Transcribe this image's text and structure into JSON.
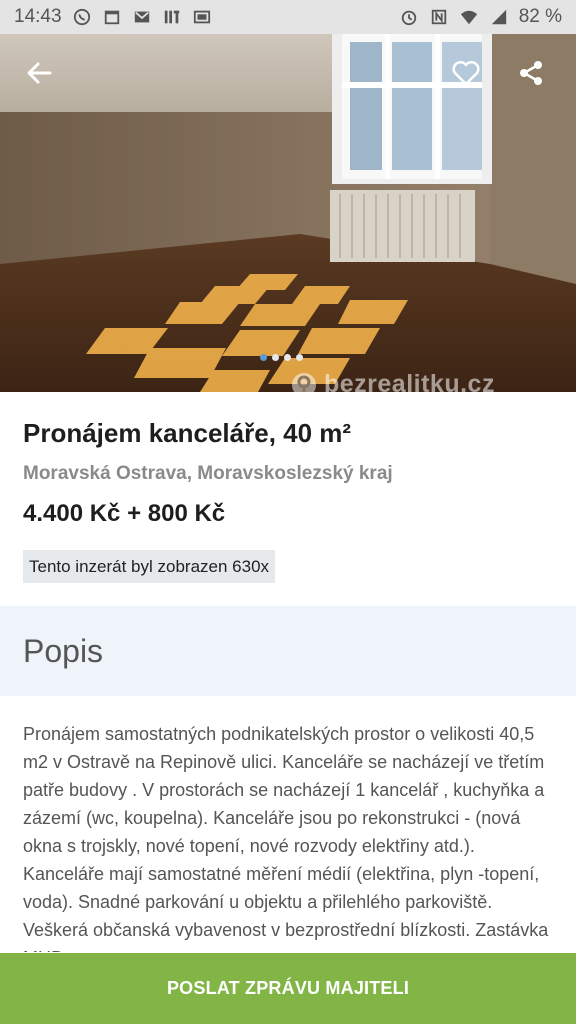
{
  "status_bar": {
    "time": "14:43",
    "battery": "82 %"
  },
  "listing": {
    "title": "Pronájem kanceláře, 40 m²",
    "location": "Moravská Ostrava, Moravskoslezský kraj",
    "price": "4.400 Kč + 800 Kč",
    "views": "Tento inzerát byl zobrazen 630x"
  },
  "gallery": {
    "total_images": 4,
    "current_image": 1,
    "watermark": "bezrealitku.cz"
  },
  "section": {
    "title": "Popis"
  },
  "description": {
    "text": "Pronájem samostatných podnikatelských prostor o velikosti 40,5 m2 v Ostravě na Repinově ulici. Kanceláře se nacházejí ve třetím patře budovy . V prostorách se nacházejí 1 kancelář , kuchyňka a zázemí (wc, koupelna). Kanceláře jsou po rekonstrukci - (nová okna s trojskly, nové topení, nové rozvody elektřiny atd.). Kanceláře mají samostatné měření médií (elektřina, plyn -topení, voda). Snadné parkování u objektu a přilehlého parkoviště. Veškerá občanská vybavenost v bezprostřední blízkosti. Zastávka MHD cca"
  },
  "cta": {
    "label": "POSLAT ZPRÁVU MAJITELI"
  },
  "colors": {
    "accent_green": "#82b546",
    "section_bg": "#eef4f9",
    "status_bar_bg": "#e4e4e4",
    "active_dot": "#5b9bd5"
  },
  "icons": {
    "back": "arrow-left-icon",
    "favorite": "heart-outline-icon",
    "share": "share-icon"
  }
}
